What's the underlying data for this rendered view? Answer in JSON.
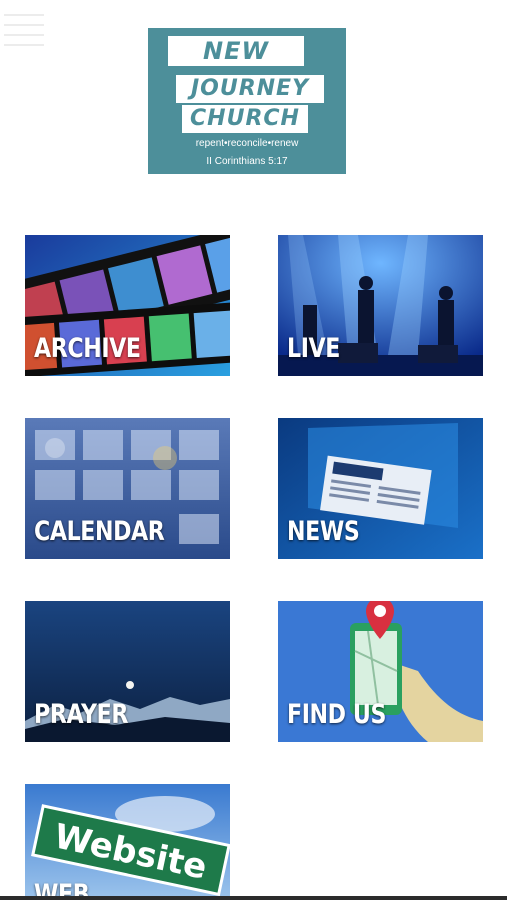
{
  "header": {
    "menu_icon": "hamburger-menu-icon",
    "logo": {
      "line1": "NEW",
      "line2": "JOURNEY",
      "line3": "CHURCH",
      "tagline": "repent•reconcile•renew",
      "verse": "II Corinthians 5:17"
    }
  },
  "tiles": [
    {
      "id": "archive",
      "label": "ARCHIVE",
      "image": "film-strip-image"
    },
    {
      "id": "live",
      "label": "LIVE",
      "image": "concert-stage-image"
    },
    {
      "id": "calendar",
      "label": "CALENDAR",
      "image": "calendar-image"
    },
    {
      "id": "news",
      "label": "NEWS",
      "image": "newspaper-image"
    },
    {
      "id": "prayer",
      "label": "PRAYER",
      "image": "moon-mountains-image"
    },
    {
      "id": "findus",
      "label": "FIND US",
      "image": "map-pin-phone-image"
    },
    {
      "id": "web",
      "label": "WEB",
      "image": "website-sign-image"
    }
  ],
  "sign_text": "Website",
  "colors": {
    "logo_teal": "#4d8f9a",
    "tile_blue": "#1e4fa0"
  }
}
